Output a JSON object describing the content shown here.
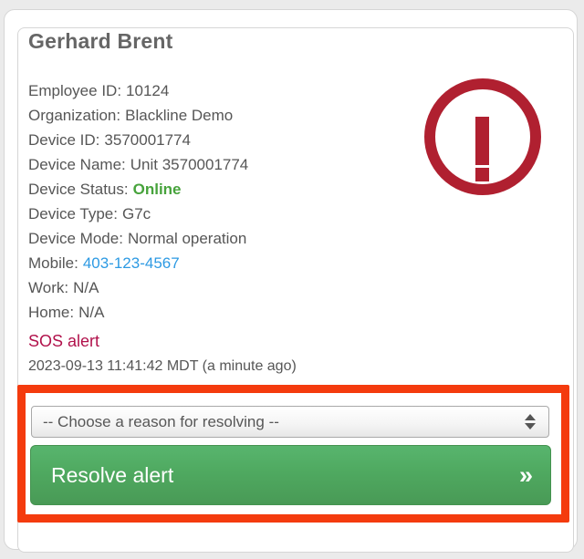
{
  "card": {
    "title": "Gerhard Brent",
    "info": [
      {
        "label": "Employee ID:",
        "value": "10124"
      },
      {
        "label": "Organization:",
        "value": "Blackline Demo"
      },
      {
        "label": "Device ID:",
        "value": "3570001774"
      },
      {
        "label": "Device Name:",
        "value": "Unit 3570001774"
      },
      {
        "label": "Device Status:",
        "value": "Online"
      },
      {
        "label": "Device Type:",
        "value": "G7c"
      },
      {
        "label": "Device Mode:",
        "value": "Normal operation"
      },
      {
        "label": "Mobile:",
        "value": "403-123-4567"
      },
      {
        "label": "Work:",
        "value": "N/A"
      },
      {
        "label": "Home:",
        "value": "N/A"
      }
    ],
    "alert": {
      "type_label": "SOS alert",
      "timestamp": "2023-09-13 11:41:42 MDT (a minute ago)",
      "icon": "exclamation-circle"
    },
    "resolve": {
      "select_placeholder": "-- Choose a reason for resolving --",
      "button_label": "Resolve alert",
      "button_icon": "»"
    }
  },
  "colors": {
    "page_background": "#ebebeb",
    "card_border": "#d6d6d6",
    "title_text": "#666666",
    "body_text": "#565656",
    "status_online_green": "#47a33c",
    "phone_link_blue": "#2d9ae3",
    "sos_alert_crimson": "#b1114b",
    "alert_icon_red": "#b02030",
    "annotation_red": "#f43b0e",
    "button_green_top": "#58b56e",
    "button_green_bottom": "#499a56"
  }
}
